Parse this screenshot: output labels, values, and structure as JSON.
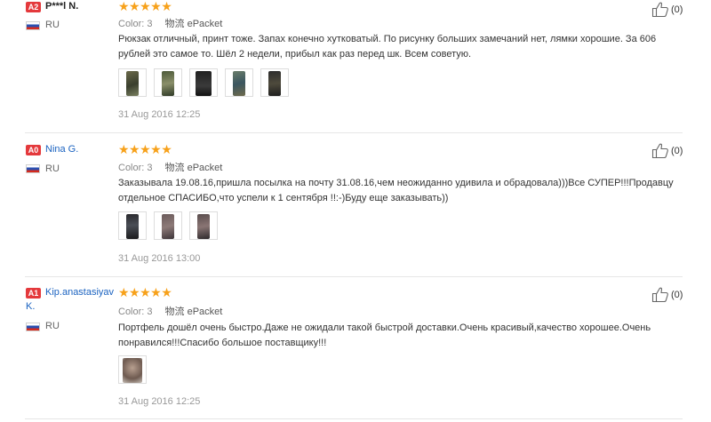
{
  "reviews": [
    {
      "badge": "A2",
      "name": "P***l N.",
      "country": "RU",
      "stars": "★★★★★",
      "color_label": "Color: 3",
      "shipping": "物流 ePacket",
      "text": "Рюкзак отличный, принт тоже. Запах конечно хутковатый. По рисунку больших замечаний нет, лямки хорошие. За 606 рублей это самое то. Шёл 2 недели, прибыл как раз перед шк. Всем советую.",
      "date": "31 Aug 2016 12:25",
      "likes": "(0)"
    },
    {
      "badge": "A0",
      "name": "Nina G.",
      "country": "RU",
      "stars": "★★★★★",
      "color_label": "Color: 3",
      "shipping": "物流 ePacket",
      "text": "Заказывала 19.08.16,пришла посылка на почту 31.08.16,чем неожиданно удивила и обрадовала)))Все СУПЕР!!!Продавцу отдельное СПАСИБО,что успели к 1 сентября !!:-)Буду еще заказывать))",
      "date": "31 Aug 2016 13:00",
      "likes": "(0)"
    },
    {
      "badge": "A1",
      "name": "Kip.anastasiyav",
      "name2": "K.",
      "country": "RU",
      "stars": "★★★★★",
      "color_label": "Color: 3",
      "shipping": "物流 ePacket",
      "text": "Портфель дошёл очень быстро.Даже не ожидали такой быстрой доставки.Очень красивый,качество хорошее.Очень понравился!!!Спасибо большое поставщику!!!",
      "date": "31 Aug 2016 12:25",
      "likes": "(0)"
    }
  ],
  "colors": {
    "badge": "#e4393c",
    "star": "#f7a11a",
    "link": "#1a62c0"
  }
}
